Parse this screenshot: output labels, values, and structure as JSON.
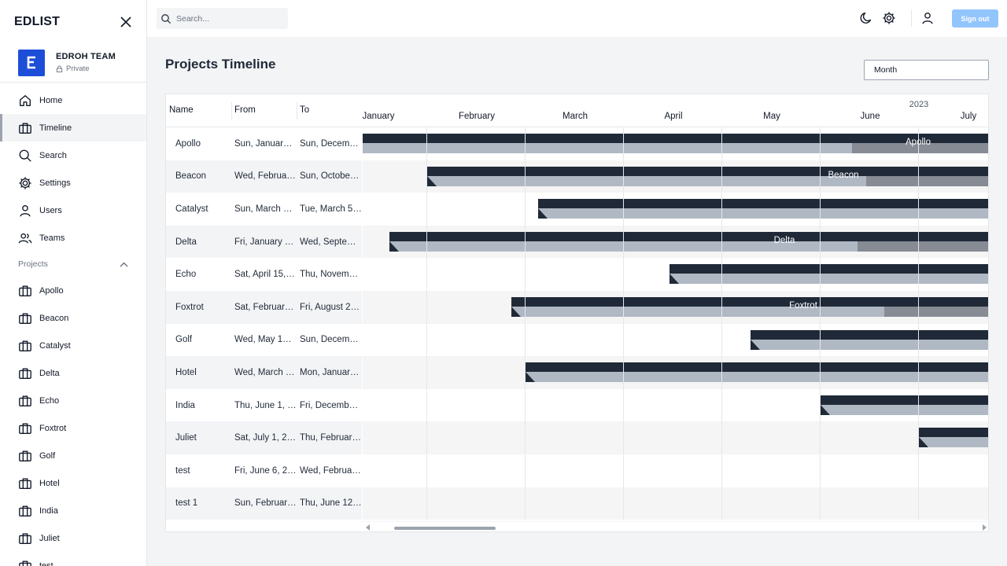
{
  "app": {
    "brand": "EDLIST"
  },
  "team": {
    "name": "EDROH TEAM",
    "visibility": "Private",
    "logo_letter": "Ɛ"
  },
  "nav": [
    {
      "label": "Home",
      "icon": "home-icon"
    },
    {
      "label": "Timeline",
      "icon": "briefcase-icon",
      "active": true
    },
    {
      "label": "Search",
      "icon": "search-icon"
    },
    {
      "label": "Settings",
      "icon": "gear-icon"
    },
    {
      "label": "Users",
      "icon": "user-icon"
    },
    {
      "label": "Teams",
      "icon": "users-icon"
    }
  ],
  "projects_section": {
    "label": "Projects"
  },
  "projects": [
    "Apollo",
    "Beacon",
    "Catalyst",
    "Delta",
    "Echo",
    "Foxtrot",
    "Golf",
    "Hotel",
    "India",
    "Juliet",
    "test"
  ],
  "topbar": {
    "search_placeholder": "Search...",
    "signout_label": "Sign out"
  },
  "main": {
    "title": "Projects Timeline",
    "view_mode": "Month"
  },
  "gantt": {
    "columns": {
      "name": "Name",
      "from": "From",
      "to": "To"
    },
    "year": "2023",
    "months": [
      "January",
      "February",
      "March",
      "April",
      "May",
      "June",
      "July"
    ],
    "rows": [
      {
        "name": "Apollo",
        "from": "Sun, Januar…",
        "to": "Sun, Decem…",
        "bar_label": "Apollo",
        "progress": 0.5
      },
      {
        "name": "Beacon",
        "from": "Wed, Februa…",
        "to": "Sun, Octobe…",
        "bar_label": "Beacon",
        "progress": 0.5
      },
      {
        "name": "Catalyst",
        "from": "Sun, March …",
        "to": "Tue, March 5…",
        "bar_label": "",
        "progress": 0
      },
      {
        "name": "Delta",
        "from": "Fri, January …",
        "to": "Wed, Septe…",
        "bar_label": "Delta",
        "progress": 0.5
      },
      {
        "name": "Echo",
        "from": "Sat, April 15,…",
        "to": "Thu, Novem…",
        "bar_label": "",
        "progress": 0
      },
      {
        "name": "Foxtrot",
        "from": "Sat, Februar…",
        "to": "Fri, August 2…",
        "bar_label": "Foxtrot",
        "progress": 0.5
      },
      {
        "name": "Golf",
        "from": "Wed, May 1…",
        "to": "Sun, Decem…",
        "bar_label": "",
        "progress": 0
      },
      {
        "name": "Hotel",
        "from": "Wed, March …",
        "to": "Mon, Januar…",
        "bar_label": "",
        "progress": 0
      },
      {
        "name": "India",
        "from": "Thu, June 1, …",
        "to": "Fri, Decemb…",
        "bar_label": "",
        "progress": 0
      },
      {
        "name": "Juliet",
        "from": "Sat, July 1, 2…",
        "to": "Thu, Februar…",
        "bar_label": "",
        "progress": 0
      },
      {
        "name": "test",
        "from": "Fri, June 6, 2…",
        "to": "Wed, Februa…",
        "bar_label": "",
        "progress": 0
      },
      {
        "name": "test 1",
        "from": "Sun, Februar…",
        "to": "Thu, June 12…",
        "bar_label": "",
        "progress": 0
      }
    ]
  }
}
